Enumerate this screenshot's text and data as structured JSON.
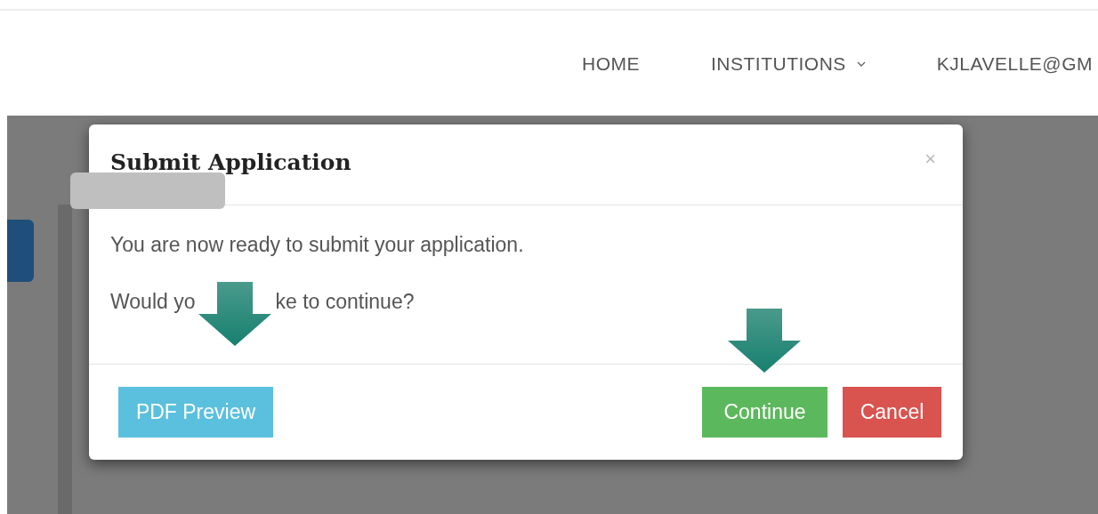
{
  "nav": [
    {
      "label": "HOME",
      "kind": "link"
    },
    {
      "label": "INSTITUTIONS",
      "kind": "dropdown"
    },
    {
      "label": "KJLAVELLE@GM",
      "kind": "link"
    }
  ],
  "modal": {
    "title": "Submit Application",
    "close": "×",
    "paragraphs": [
      {
        "parts": [
          "You are now ready to submit your application."
        ]
      },
      {
        "parts": [
          "Would yo",
          "ke to continue?"
        ]
      }
    ],
    "buttons": [
      {
        "label": "PDF Preview",
        "kind": "info"
      },
      {
        "label": "Continue",
        "kind": "success"
      },
      {
        "label": "Cancel",
        "kind": "danger"
      }
    ]
  }
}
